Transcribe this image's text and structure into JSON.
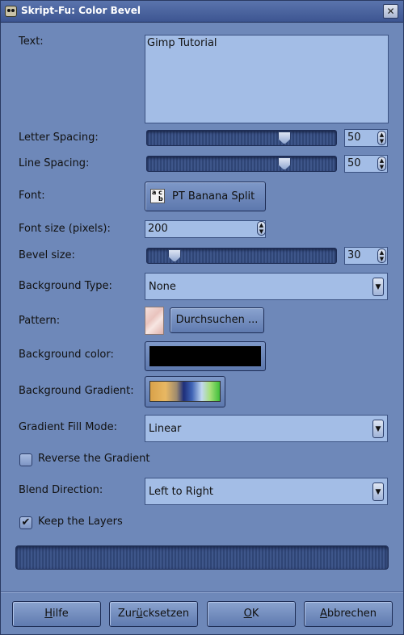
{
  "window": {
    "title": "Skript-Fu: Color Bevel",
    "close_glyph": "✕"
  },
  "fields": {
    "text": {
      "label": "Text:",
      "value": "Gimp Tutorial"
    },
    "letter_spacing": {
      "label": "Letter Spacing:",
      "value": "50",
      "slider_level": 0.73
    },
    "line_spacing": {
      "label": "Line Spacing:",
      "value": "50",
      "slider_level": 0.73
    },
    "font": {
      "label": "Font:",
      "value": "PT Banana Split",
      "icon": "font-icon",
      "icon_glyph_top": "a c",
      "icon_glyph_bottom": "b"
    },
    "font_size": {
      "label": "Font size (pixels):",
      "value": "200"
    },
    "bevel_size": {
      "label": "Bevel size:",
      "value": "30",
      "slider_level": 0.14
    },
    "background_type": {
      "label": "Background Type:",
      "value": "None"
    },
    "pattern": {
      "label": "Pattern:",
      "button": "Durchsuchen ..."
    },
    "background_color": {
      "label": "Background color:",
      "color": "#000000"
    },
    "background_gradient": {
      "label": "Background Gradient:"
    },
    "gradient_fill_mode": {
      "label": "Gradient Fill Mode:",
      "value": "Linear"
    },
    "reverse_gradient": {
      "label": "Reverse the Gradient",
      "checked": false
    },
    "blend_direction": {
      "label": "Blend Direction:",
      "value": "Left to Right"
    },
    "keep_layers": {
      "label": "Keep the Layers",
      "checked": true,
      "check_glyph": "✔"
    }
  },
  "buttons": {
    "help_mnemonic": "H",
    "help_rest": "ilfe",
    "reset_pre": "Zur",
    "reset_mnemonic": "ü",
    "reset_rest": "cksetzen",
    "ok_mnemonic": "O",
    "ok_rest": "K",
    "cancel_mnemonic": "A",
    "cancel_rest": "bbrechen"
  },
  "colors": {
    "accent": "#6e88b9",
    "titlebar": "#3d5591",
    "entry": "#a3bde6"
  }
}
